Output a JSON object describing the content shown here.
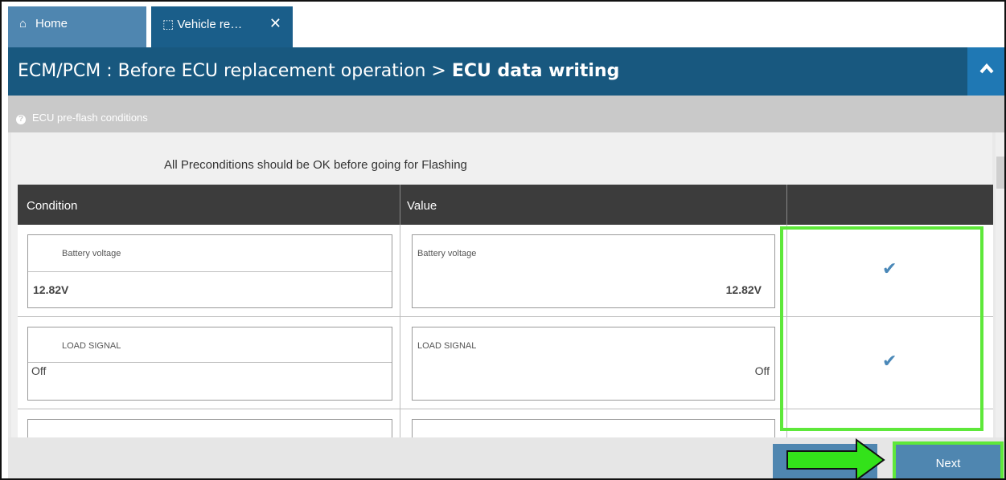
{
  "tabs": {
    "home_label": "Home",
    "vehicle_label": "Vehicle re…",
    "close_glyph": "✕"
  },
  "header": {
    "prefix": "ECM/PCM",
    "separator": " : ",
    "path": "Before ECU replacement operation > ",
    "current": "ECU data writing",
    "collapse_glyph": "^"
  },
  "section": {
    "title": "ECU pre-flash conditions"
  },
  "notice": "All Preconditions should be OK before going for Flashing",
  "table": {
    "columns": [
      "Condition",
      "Value",
      ""
    ],
    "rows": [
      {
        "condition_label": "Battery voltage",
        "condition_value": "12.82V",
        "value_label": "Battery voltage",
        "value_value": "12.82V",
        "status": "ok"
      },
      {
        "condition_label": "LOAD SIGNAL",
        "condition_value": "Off",
        "value_label": "LOAD SIGNAL",
        "value_value": "Off",
        "status": "ok"
      }
    ]
  },
  "footer": {
    "next_label": "Next"
  },
  "colors": {
    "accent": "#18587f",
    "button": "#4f86b0",
    "highlight": "#5ee83a",
    "check": "#4a88b8"
  }
}
